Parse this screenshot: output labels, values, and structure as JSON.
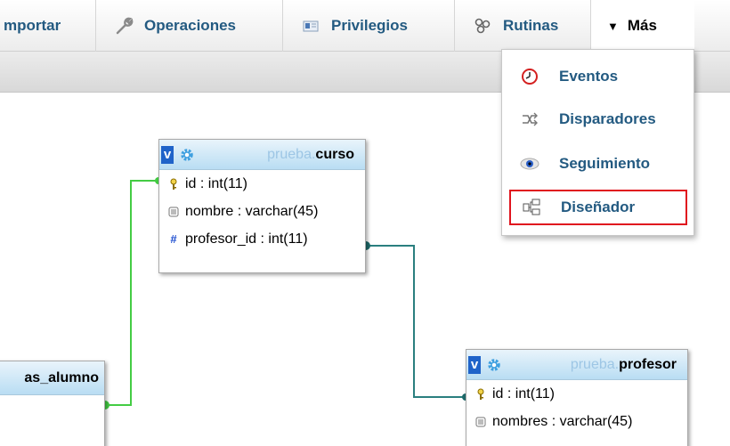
{
  "nav": {
    "tabs": [
      {
        "label": "mportar",
        "icon": "import-icon"
      },
      {
        "label": "Operaciones",
        "icon": "wrench-icon"
      },
      {
        "label": "Privilegios",
        "icon": "privileges-icon"
      },
      {
        "label": "Rutinas",
        "icon": "routines-icon"
      },
      {
        "label": "Más",
        "icon": "triangle-down-icon"
      }
    ]
  },
  "dropdown": {
    "items": [
      {
        "label": "Eventos",
        "icon": "clock-icon"
      },
      {
        "label": "Disparadores",
        "icon": "trigger-icon"
      },
      {
        "label": "Seguimiento",
        "icon": "eye-icon"
      },
      {
        "label": "Diseñador",
        "icon": "designer-icon"
      }
    ],
    "highlight_color": "#e0141e"
  },
  "designer": {
    "tables": {
      "curso": {
        "db": "prueba.",
        "name": "curso",
        "toggle": "v",
        "columns": [
          {
            "text": "id : int(11)",
            "icon": "key-icon"
          },
          {
            "text": "nombre : varchar(45)",
            "icon": "column-icon"
          },
          {
            "text": "profesor_id : int(11)",
            "icon": "hash-icon"
          }
        ]
      },
      "profesor": {
        "db": "prueba.",
        "name": "profesor",
        "toggle": "v",
        "columns": [
          {
            "text": "id : int(11)",
            "icon": "key-icon"
          },
          {
            "text": "nombres : varchar(45)",
            "icon": "column-icon"
          }
        ]
      },
      "alumno": {
        "name": "as_alumno"
      }
    },
    "relation_colors": {
      "green": "#44cc44",
      "teal": "#2a7f7f"
    }
  }
}
